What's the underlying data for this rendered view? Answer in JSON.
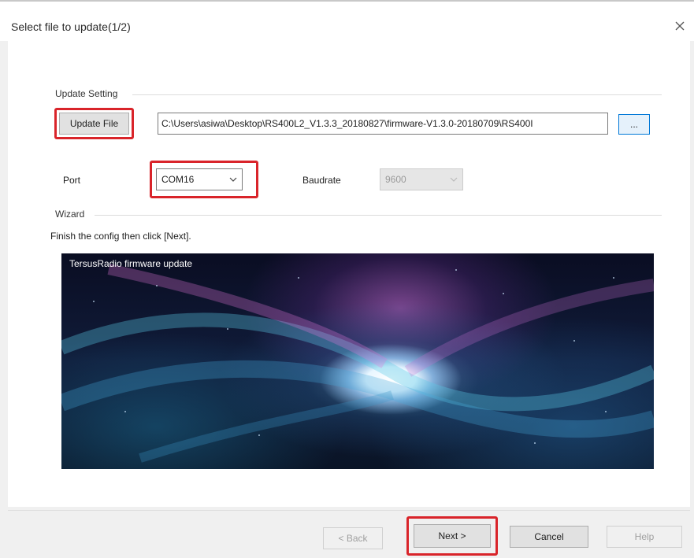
{
  "window": {
    "title": "Select file to update(1/2)",
    "close_glyph": "×"
  },
  "update_setting": {
    "group_label": "Update Setting",
    "update_file_button": "Update File",
    "file_path": "C:\\Users\\asiwa\\Desktop\\RS400L2_V1.3.3_20180827\\firmware-V1.3.0-20180709\\RS400I",
    "browse_button": "...",
    "port_label": "Port",
    "port_value": "COM16",
    "baudrate_label": "Baudrate",
    "baudrate_value": "9600"
  },
  "wizard": {
    "group_label": "Wizard",
    "instruction": "Finish the config then click [Next].",
    "banner_caption": "TersusRadio firmware update"
  },
  "footer": {
    "back_button": "< Back",
    "next_button": "Next >",
    "cancel_button": "Cancel",
    "help_button": "Help"
  },
  "colors": {
    "highlight_box": "#d9242a",
    "browse_button_border": "#0078d7"
  },
  "icons": {
    "close": "close-icon",
    "combo_arrow": "chevron-down-icon"
  }
}
